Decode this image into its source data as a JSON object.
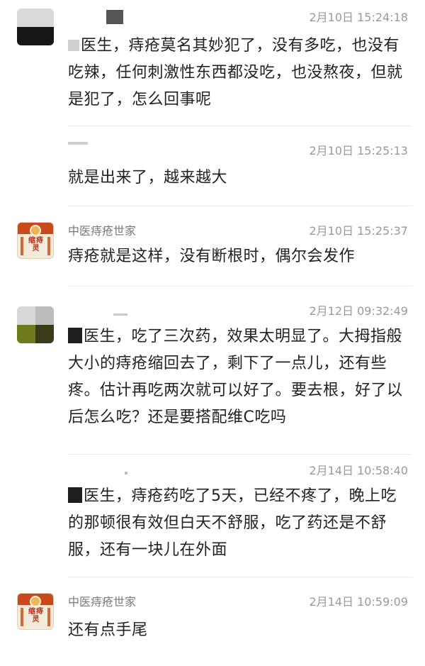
{
  "comments": [
    {
      "author": "",
      "time": "2月10日 15:24:18",
      "text": "医生，痔疮莫名其妙犯了，没有多吃，也没有吃辣，任何刺激性东西都没吃，也没熬夜，但就是犯了，怎么回事呢",
      "lead_mark": false
    },
    {
      "author": "",
      "time": "2月10日 15:25:13",
      "text": "就是出来了，越来越大",
      "lead_mark": false
    },
    {
      "author": "中医痔疮世家",
      "avatar_text": "缩痔灵",
      "time": "2月10日 15:25:37",
      "text": "痔疮就是这样，没有断根时，偶尔会发作"
    },
    {
      "author": "",
      "time": "2月12日 09:32:49",
      "text": "医生，吃了三次药，效果太明显了。大拇指般大小的痔疮缩回去了，剩下了一点儿，还有些疼。估计再吃两次就可以好了。要去根，好了以后怎么吃？还是要搭配维C吃吗",
      "lead_mark": true
    },
    {
      "author": "",
      "time": "2月14日 10:58:40",
      "text": "医生，痔疮药吃了5天，已经不疼了，晚上吃的那顿很有效但白天不舒服，吃了药还是不舒服，还有一块儿在外面",
      "lead_mark": true
    },
    {
      "author": "中医痔疮世家",
      "avatar_text": "缩痔灵",
      "time": "2月14日 10:59:09",
      "text": "还有点手尾"
    }
  ],
  "colors": {
    "text": "#222222",
    "meta": "#9a9a9a",
    "brand_red": "#c84a1c"
  }
}
